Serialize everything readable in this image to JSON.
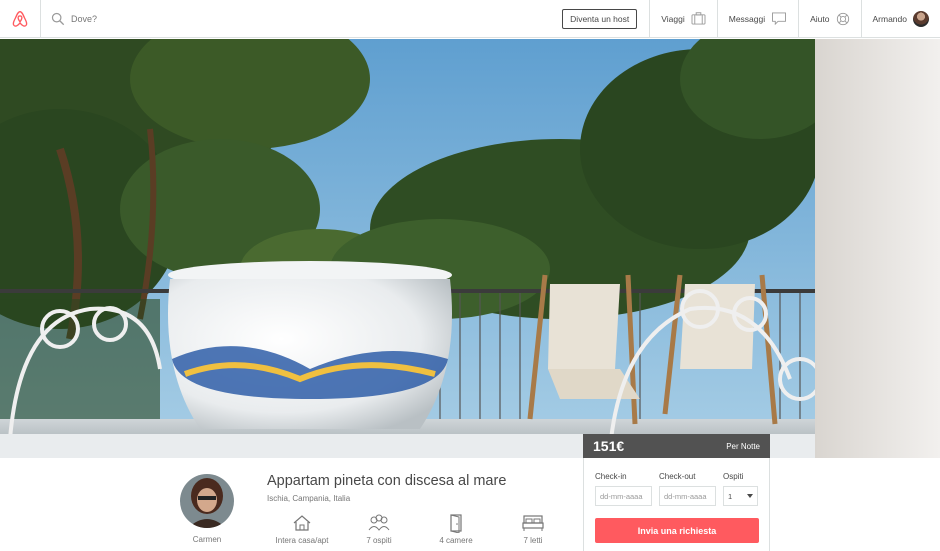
{
  "colors": {
    "brand": "#ff5a5f",
    "text": "#484848",
    "muted": "#767676"
  },
  "nav": {
    "logo_icon": "airbnb-logo-icon",
    "search_placeholder": "Dove?",
    "host_button": "Diventa un host",
    "trips": "Viaggi",
    "messages": "Messaggi",
    "help": "Aiuto",
    "user": "Armando"
  },
  "listing": {
    "price": "151€",
    "per_night": "Per Notte",
    "title": "Appartam pineta con discesa al mare",
    "location": "Ischia, Campania, Italia",
    "host_name": "Carmen",
    "features": [
      {
        "icon": "house-icon",
        "label": "Intera casa/apt"
      },
      {
        "icon": "guests-icon",
        "label": "7 ospiti"
      },
      {
        "icon": "door-icon",
        "label": "4 camere"
      },
      {
        "icon": "bed-icon",
        "label": "7 letti"
      }
    ]
  },
  "booking": {
    "checkin_label": "Check-in",
    "checkout_label": "Check-out",
    "guests_label": "Ospiti",
    "checkin_placeholder": "dd-mm-aaaa",
    "checkout_placeholder": "dd-mm-aaaa",
    "guests_value": "1",
    "submit": "Invia una richiesta"
  }
}
